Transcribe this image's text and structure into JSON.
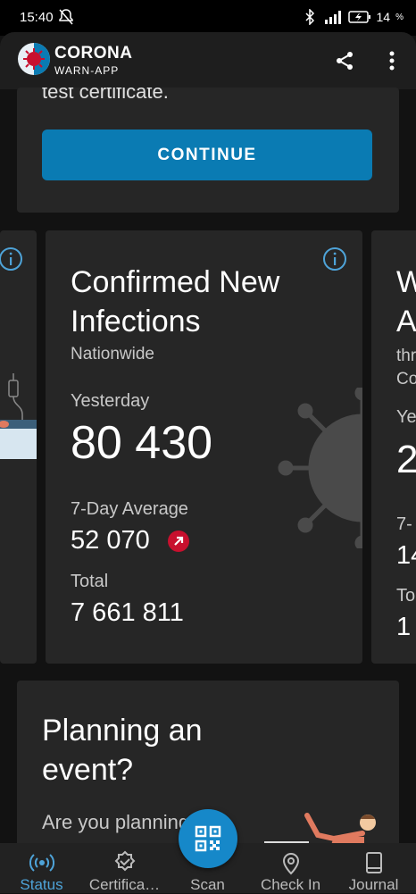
{
  "status_bar": {
    "time": "15:40",
    "battery": "14"
  },
  "app_bar": {
    "title": "CORONA",
    "subtitle": "WARN-APP"
  },
  "certificate_card": {
    "text": "test certificate.",
    "button": "CONTINUE"
  },
  "infections_card": {
    "title": "Confirmed New Infections",
    "region": "Nationwide",
    "yesterday_label": "Yesterday",
    "yesterday_value": "80 430",
    "avg_label": "7-Day Average",
    "avg_value": "52 070",
    "total_label": "Total",
    "total_value": "7 661 811"
  },
  "right_card_partial": {
    "title_lines": [
      "W",
      "A"
    ],
    "sub_lines": [
      "thr",
      "Co"
    ],
    "yesterday_label": "Ye",
    "yesterday_value": "2",
    "avg_label": "7-",
    "avg_value": "14",
    "total_label": "To",
    "total_value": "1"
  },
  "event_card": {
    "title": "Planning an event?",
    "text": "Are you planning"
  },
  "bottom_nav": [
    {
      "label": "Status",
      "icon": "status-icon"
    },
    {
      "label": "Certifica…",
      "icon": "certificate-icon"
    },
    {
      "label": "Scan",
      "icon": "qr-icon"
    },
    {
      "label": "Check In",
      "icon": "location-pin-icon"
    },
    {
      "label": "Journal",
      "icon": "journal-icon"
    }
  ],
  "colors": {
    "accent": "#1688c9",
    "active_tab": "#4ea3d8",
    "trend_up": "#c8102e"
  }
}
